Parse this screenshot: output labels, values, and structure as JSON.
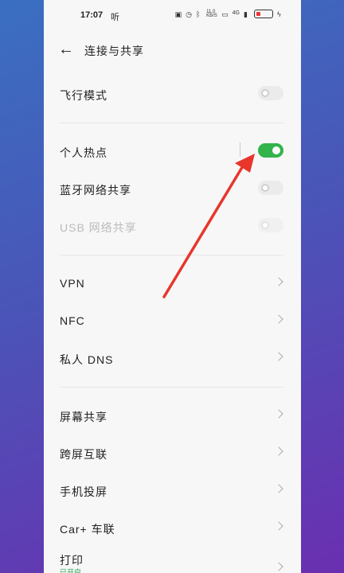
{
  "status_bar": {
    "time": "17:07",
    "carrier": "听",
    "net_speed": "11.0 KB/S",
    "network": "4G"
  },
  "header": {
    "back_icon": "arrow-left-icon",
    "title": "连接与共享"
  },
  "rows": [
    {
      "label": "飞行模式",
      "type": "toggle",
      "state": "off"
    },
    {
      "label": "个人热点",
      "type": "toggle",
      "state": "on"
    },
    {
      "label": "蓝牙网络共享",
      "type": "toggle",
      "state": "off"
    },
    {
      "label": "USB 网络共享",
      "type": "toggle",
      "state": "disabled"
    },
    {
      "label": "VPN",
      "type": "chevron"
    },
    {
      "label": "NFC",
      "type": "chevron"
    },
    {
      "label": "私人 DNS",
      "type": "chevron"
    },
    {
      "label": "屏幕共享",
      "type": "chevron"
    },
    {
      "label": "跨屏互联",
      "type": "chevron"
    },
    {
      "label": "手机投屏",
      "type": "chevron"
    },
    {
      "label": "Car+ 车联",
      "type": "chevron"
    },
    {
      "label": "打印",
      "type": "chevron",
      "sublabel": "已开启"
    }
  ],
  "colors": {
    "toggle_on": "#33b34b",
    "annotation_arrow": "#e8362b"
  }
}
